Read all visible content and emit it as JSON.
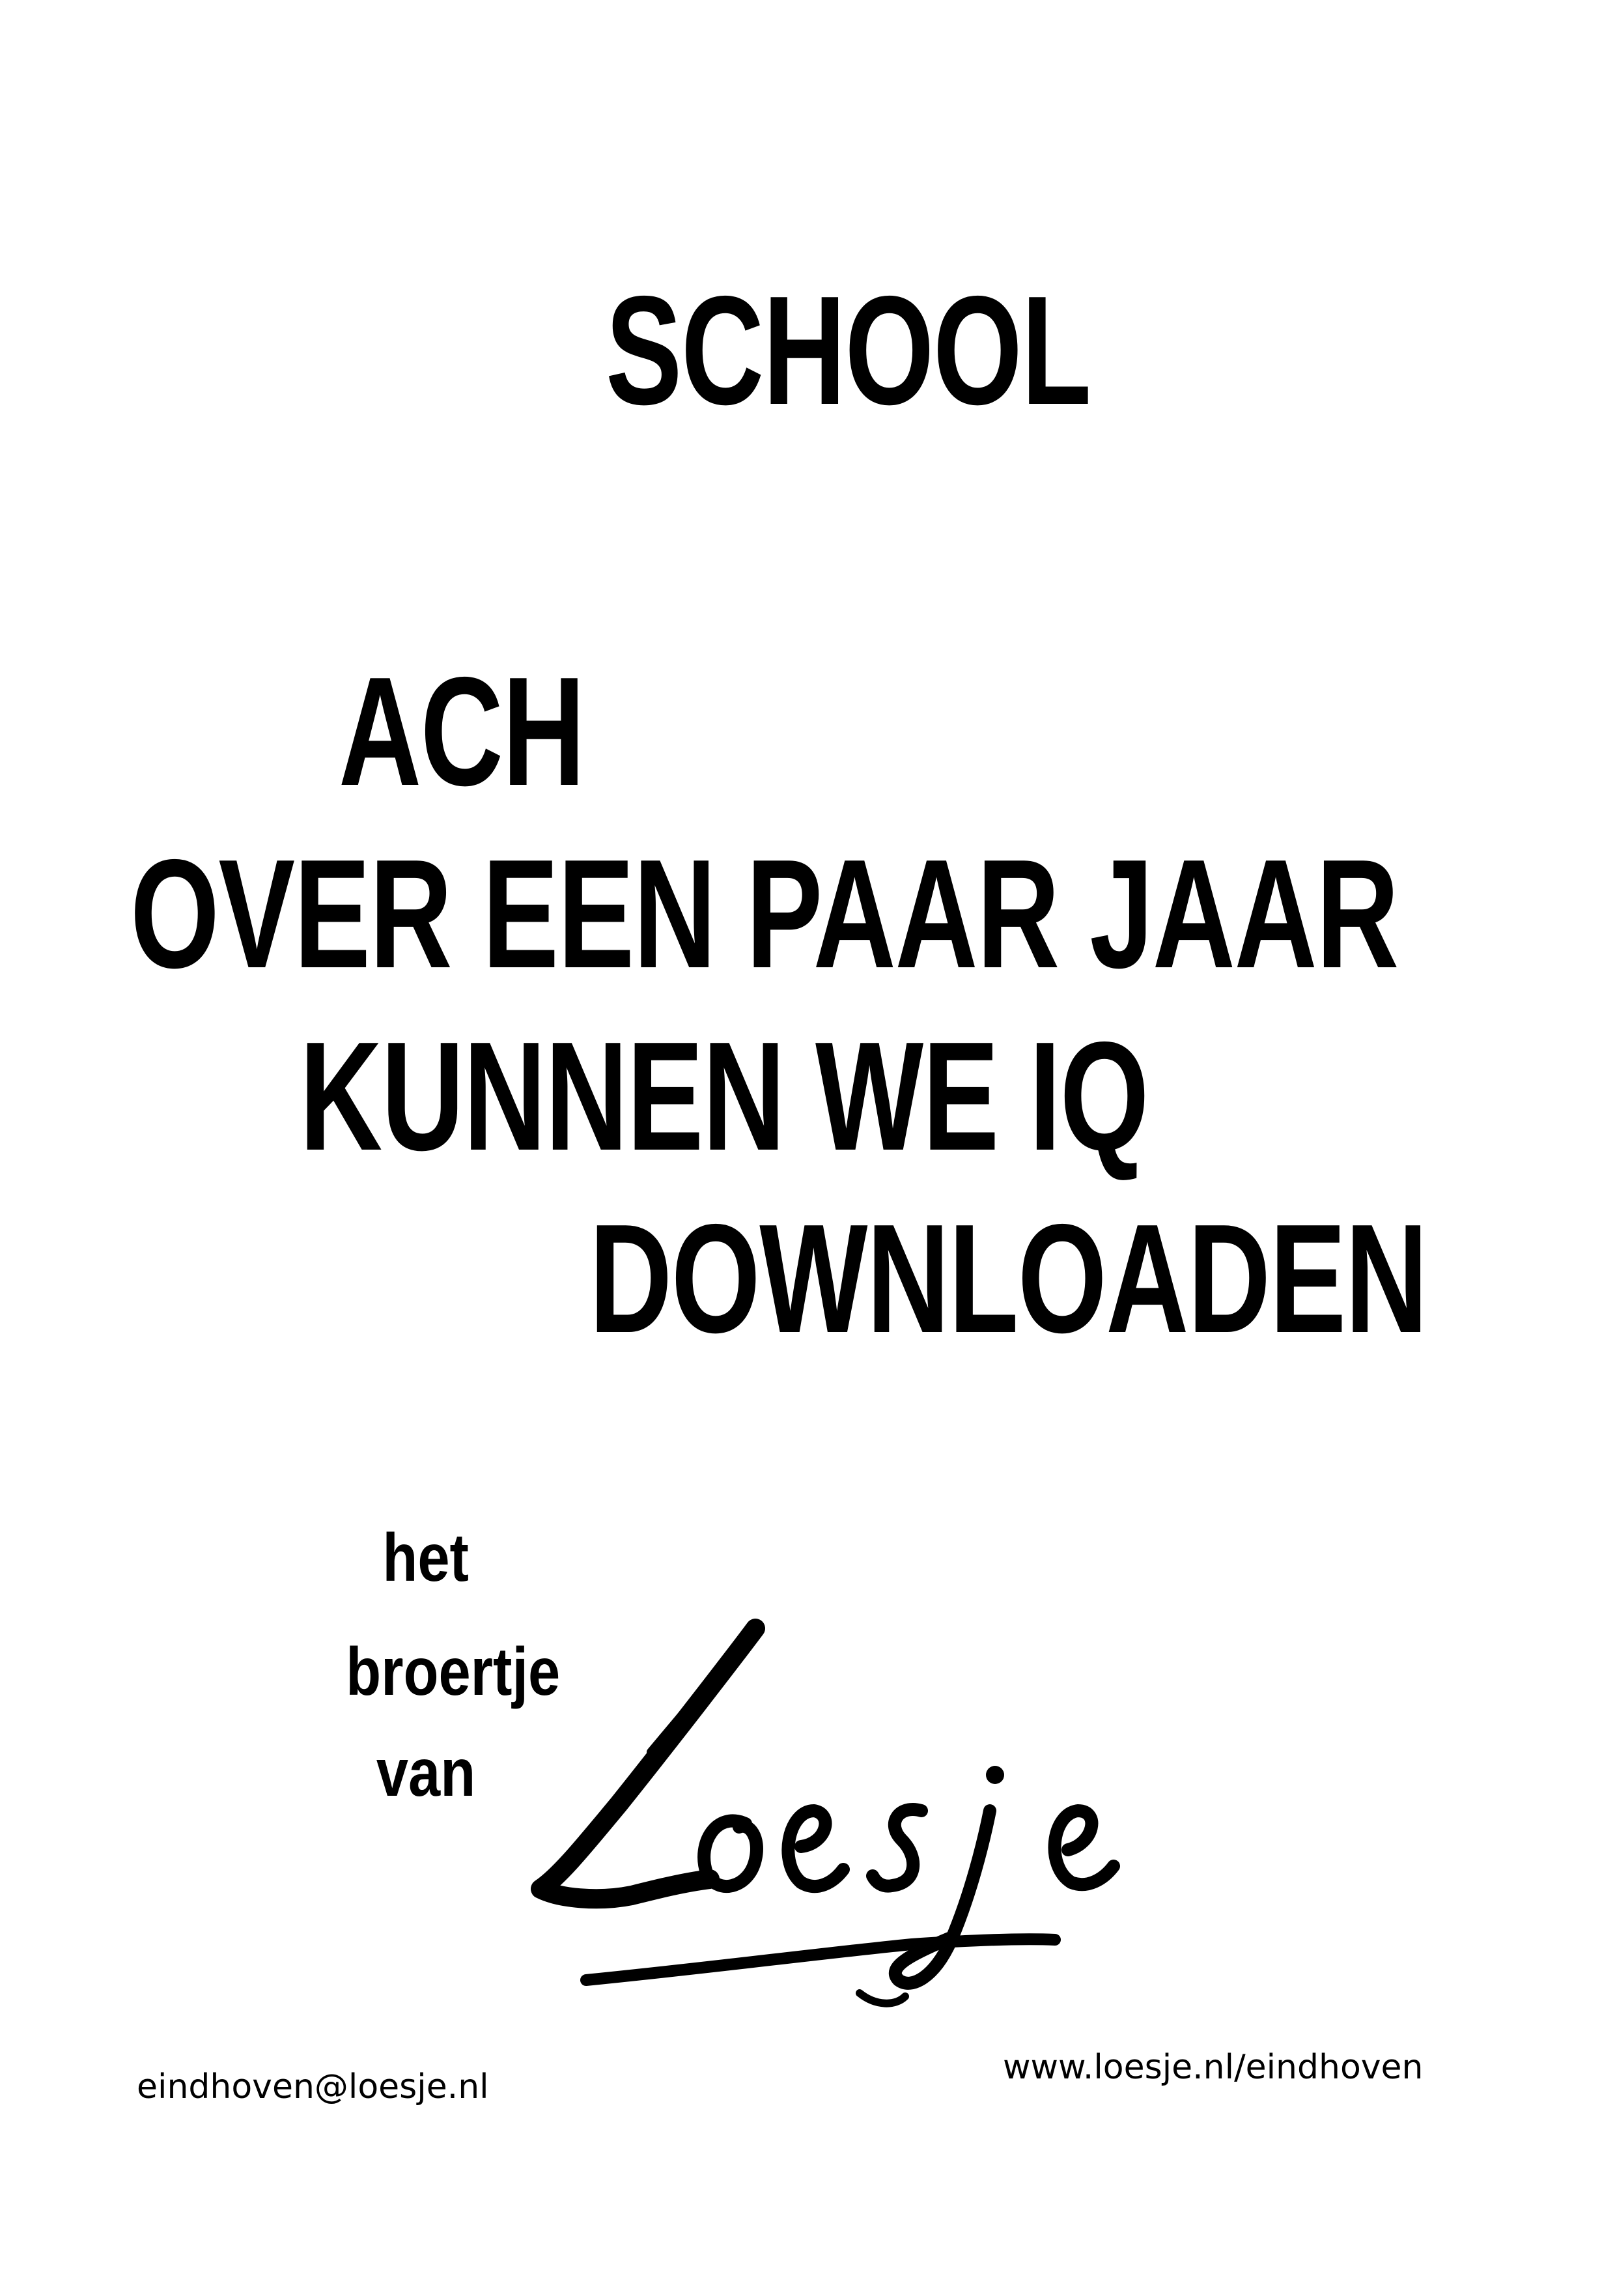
{
  "poster": {
    "title": "SCHOOL",
    "lines": [
      "ACH",
      "OVER EEN PAAR JAAR",
      "KUNNEN WE IQ",
      "DOWNLOADEN"
    ],
    "signoff": [
      "het",
      "broertje",
      "van"
    ],
    "signature": "Loesje"
  },
  "footer": {
    "email": "eindhoven@loesje.nl",
    "url": "www.loesje.nl/eindhoven"
  },
  "colors": {
    "background": "#ffffff",
    "text": "#000000"
  }
}
